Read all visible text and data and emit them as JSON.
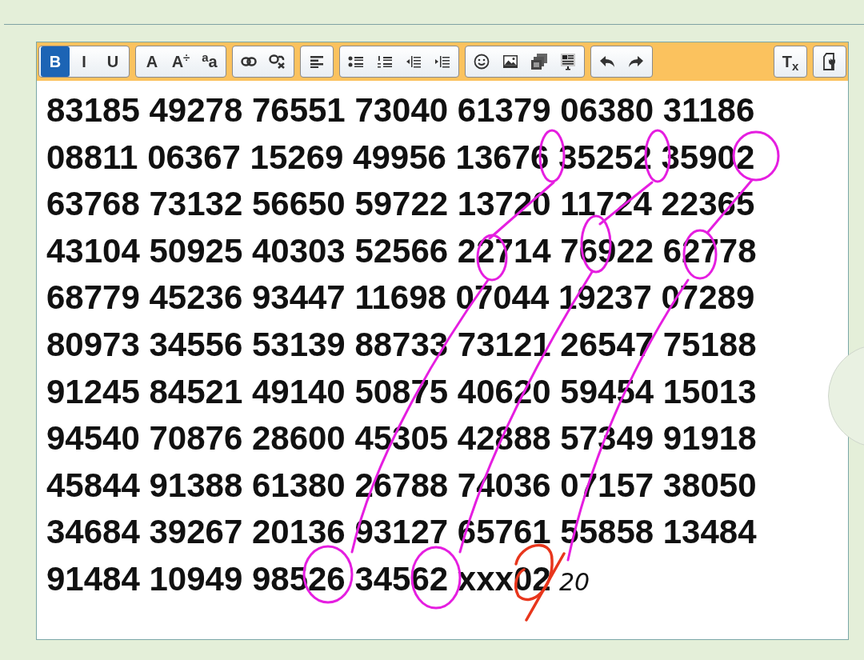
{
  "toolbar": {
    "groups": [
      {
        "buttons": [
          {
            "kind": "text",
            "label": "B",
            "selected": true
          },
          {
            "kind": "text",
            "label": "I",
            "selected": false
          },
          {
            "kind": "text",
            "label": "U",
            "selected": false
          }
        ]
      },
      {
        "buttons": [
          {
            "kind": "text",
            "label": "A",
            "selected": false
          },
          {
            "kind": "text",
            "label": "A$^{÷}$",
            "selected": false
          },
          {
            "kind": "text",
            "label": "$^{a}$a",
            "selected": false
          }
        ]
      },
      {
        "buttons": [
          {
            "kind": "icon",
            "selected": false
          },
          {
            "kind": "icon",
            "selected": false
          }
        ]
      },
      {
        "buttons": [
          {
            "kind": "icon",
            "selected": false
          }
        ]
      },
      {
        "buttons": [
          {
            "kind": "icon",
            "selected": false
          },
          {
            "kind": "icon",
            "selected": false
          },
          {
            "kind": "icon",
            "selected": false
          },
          {
            "kind": "icon",
            "selected": false
          }
        ]
      },
      {
        "buttons": [
          {
            "kind": "icon",
            "selected": false
          },
          {
            "kind": "icon",
            "selected": false
          },
          {
            "kind": "icon",
            "selected": false
          },
          {
            "kind": "icon",
            "selected": false
          }
        ]
      },
      {
        "buttons": [
          {
            "kind": "icon",
            "selected": false
          },
          {
            "kind": "icon",
            "selected": false
          }
        ]
      }
    ],
    "right_buttons": [
      {
        "kind": "text",
        "label": "T$_{x}$",
        "selected": false
      },
      {
        "kind": "icon",
        "selected": false
      }
    ]
  },
  "content": {
    "lines": [
      "83185 49278 76551 73040 61379 06380 31186",
      "08811 06367 15269 49956 13676 35252 35902",
      "63768 73132 56650 59722 13720 11724 22365",
      "43104 50925 40303 52566 22714 76922 62778",
      "68779 45236 93447 11698 07044 19237 07289",
      "80973 34556 53139 88733 73121 26547 75188",
      "91245 84521 49140 50875 40620 59454 15013",
      "94540 70876 28600 45305 42888 57349 91918",
      "45844 91388 61380 26788 74036 07157 38050",
      "34684 39267 20136 93127 65761 55858 13484",
      "91484 10949 98526 34562 xxx02"
    ],
    "handwritten_note": "20"
  }
}
